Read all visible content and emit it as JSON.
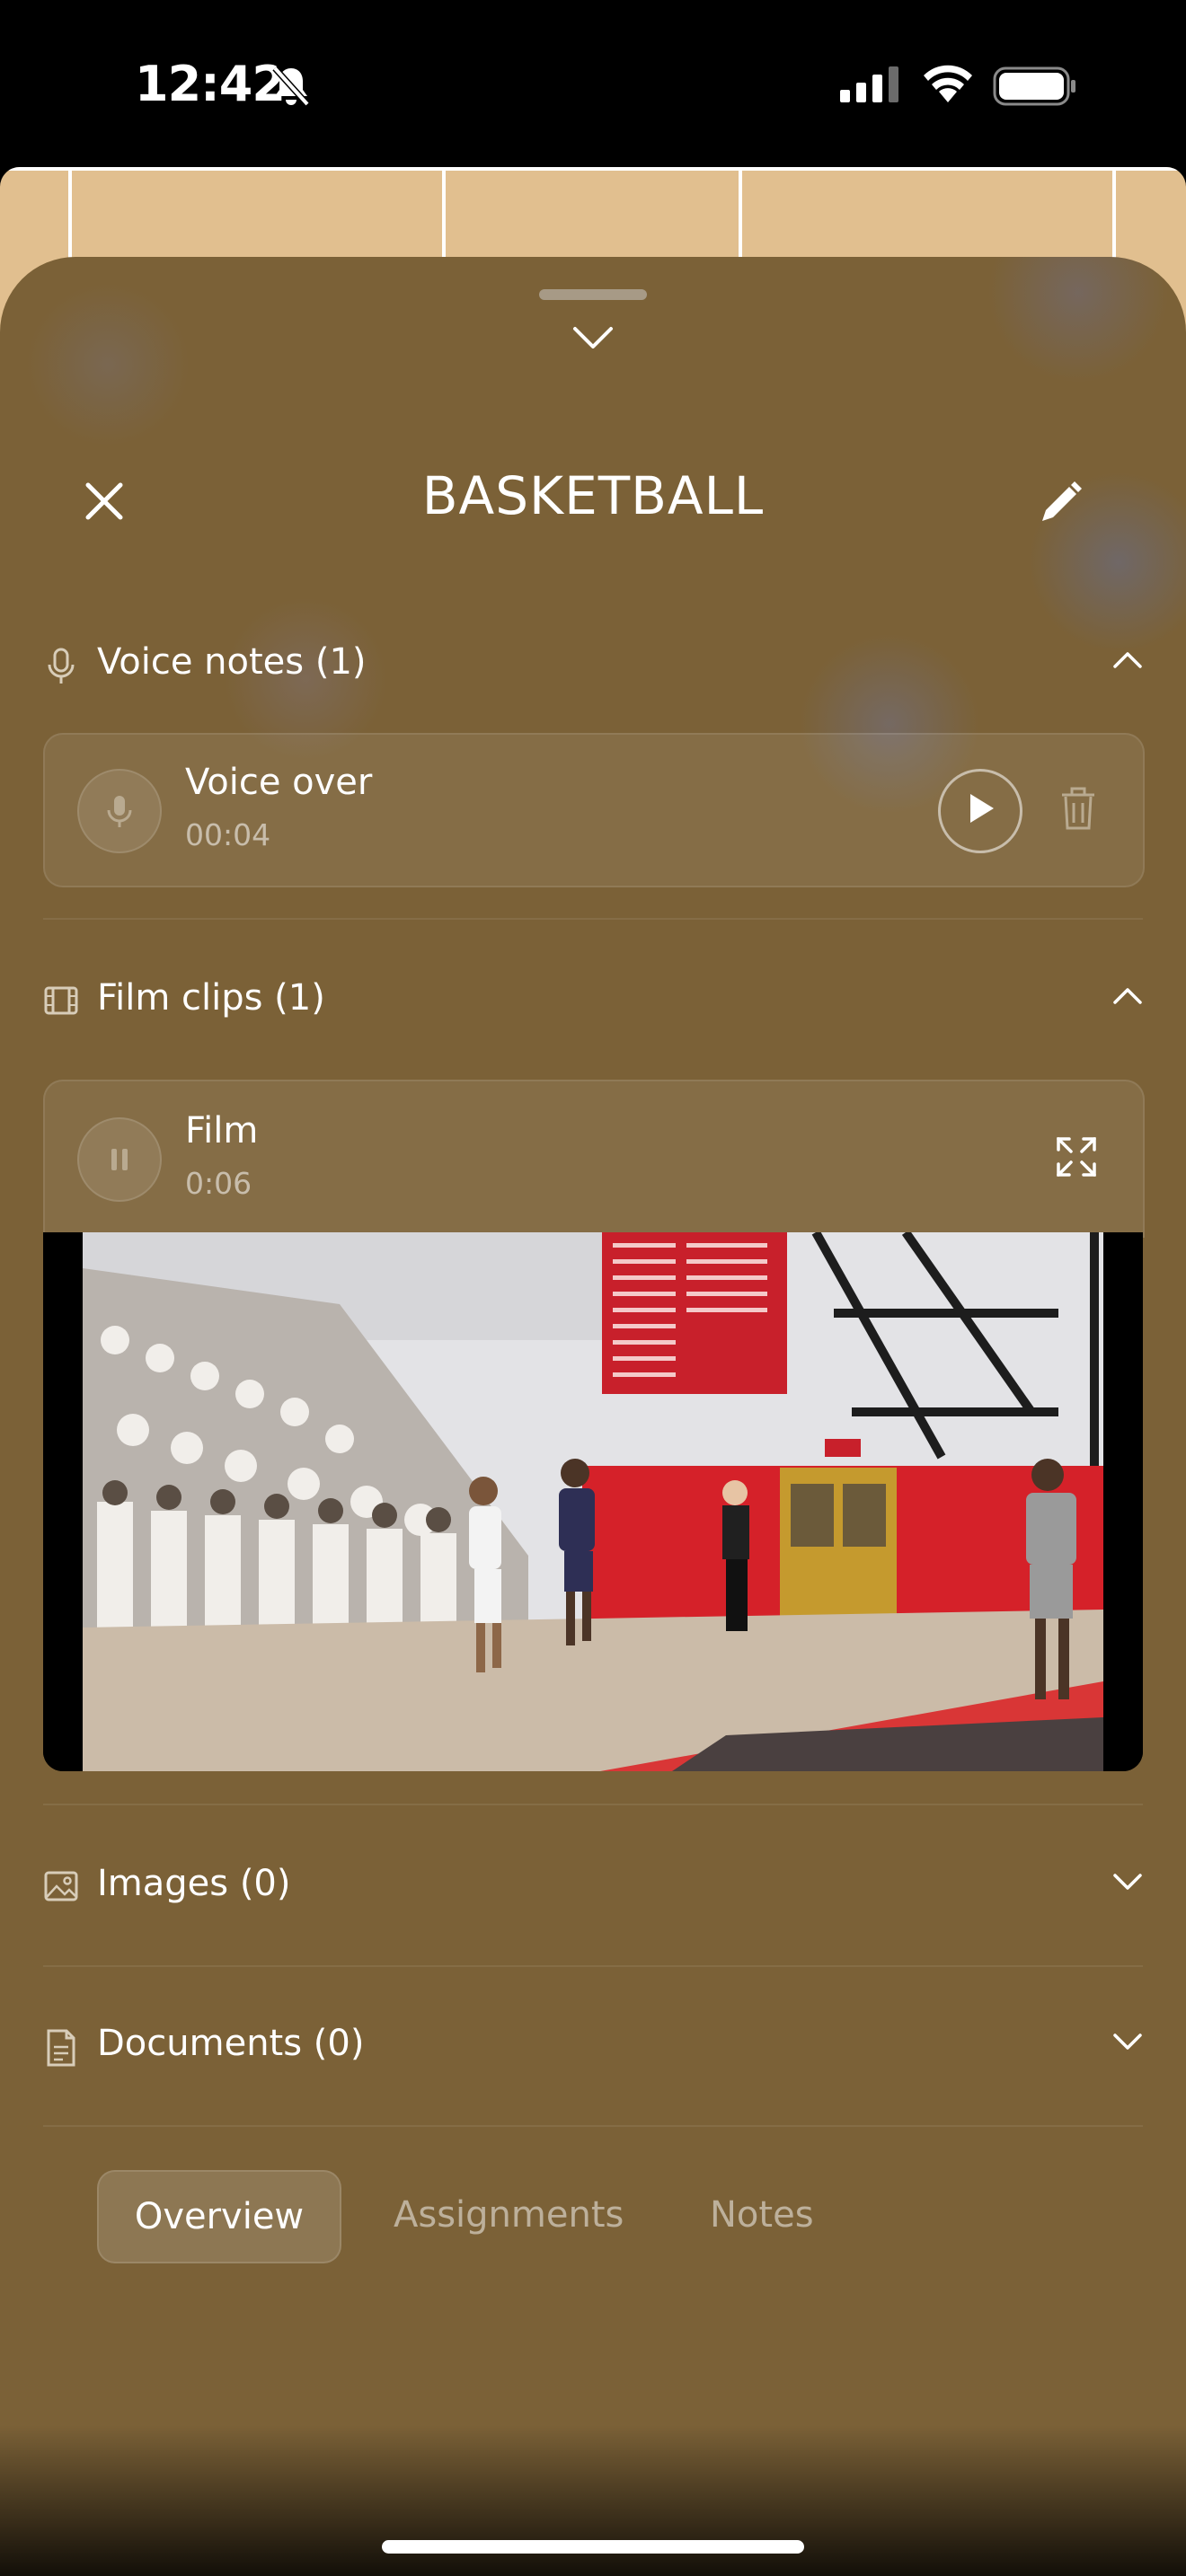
{
  "status_bar": {
    "time": "12:42"
  },
  "sheet": {
    "title": "BASKETBALL",
    "sections": {
      "voice_notes": {
        "label": "Voice notes (1)",
        "items": [
          {
            "title": "Voice over",
            "duration": "00:04"
          }
        ]
      },
      "film_clips": {
        "label": "Film clips (1)",
        "items": [
          {
            "title": "Film",
            "duration": "0:06"
          }
        ]
      },
      "images": {
        "label": "Images (0)"
      },
      "documents": {
        "label": "Documents (0)"
      }
    },
    "tabs": [
      {
        "label": "Overview",
        "active": true
      },
      {
        "label": "Assignments",
        "active": false
      },
      {
        "label": "Notes",
        "active": false
      }
    ]
  },
  "icons": {
    "close": "close-icon",
    "edit": "pencil-icon",
    "collapse": "chevron-down-icon",
    "mic": "microphone-icon",
    "film": "film-icon",
    "image": "image-icon",
    "document": "document-icon",
    "play": "play-icon",
    "pause": "pause-icon",
    "trash": "trash-icon",
    "expand": "expand-icon"
  },
  "colors": {
    "sheet_bg": "#7b6137",
    "court": "#e1bf8f",
    "text": "#ffffff"
  }
}
